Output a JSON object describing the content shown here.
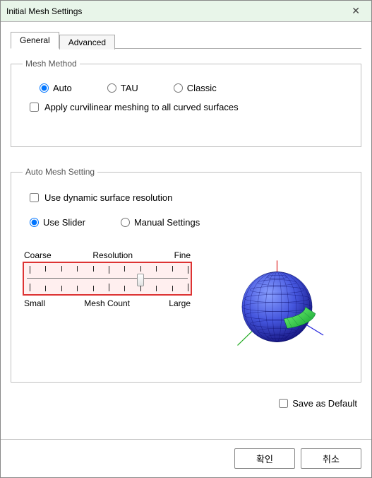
{
  "window": {
    "title": "Initial Mesh Settings"
  },
  "tabs": {
    "general": "General",
    "advanced": "Advanced",
    "active": "general"
  },
  "mesh_method": {
    "legend": "Mesh Method",
    "options": {
      "auto": "Auto",
      "tau": "TAU",
      "classic": "Classic"
    },
    "selected": "auto",
    "curvilinear_label": "Apply curvilinear meshing to all curved surfaces",
    "curvilinear_checked": false
  },
  "auto_mesh": {
    "legend": "Auto Mesh Setting",
    "dyn_label": "Use dynamic surface resolution",
    "dyn_checked": false,
    "mode_slider": "Use Slider",
    "mode_manual": "Manual Settings",
    "mode_selected": "slider",
    "slider": {
      "top_left": "Coarse",
      "top_mid": "Resolution",
      "top_right": "Fine",
      "bot_left": "Small",
      "bot_mid": "Mesh Count",
      "bot_right": "Large",
      "ticks": 11,
      "value": 7
    }
  },
  "save_default": {
    "label": "Save as Default",
    "checked": false
  },
  "buttons": {
    "ok": "확인",
    "cancel": "취소"
  }
}
